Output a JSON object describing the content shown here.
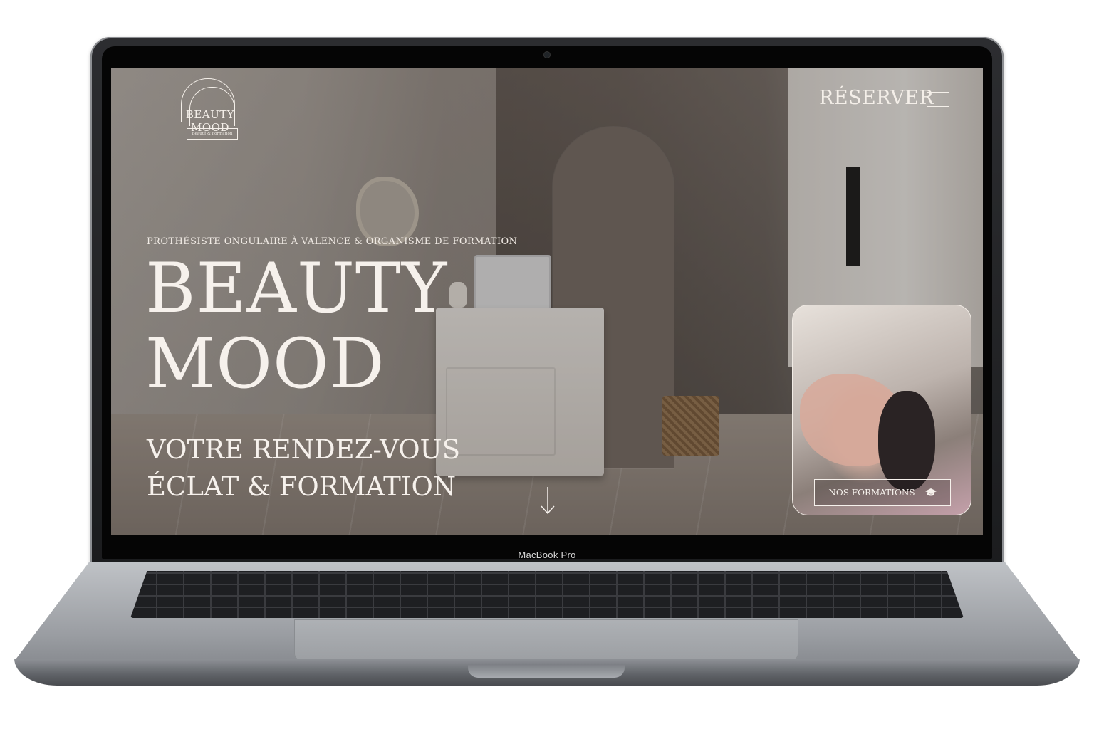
{
  "device": {
    "label": "MacBook Pro"
  },
  "site": {
    "logo": {
      "name": "BEAUTY MOOD",
      "subtitle": "Beauté & Formation"
    },
    "header": {
      "reserve_label": "RÉSERVER"
    },
    "hero": {
      "tagline": "PROTHÉSISTE ONGULAIRE À VALENCE & ORGANISME DE FORMATION",
      "title_line1": "BEAUTY",
      "title_line2": "MOOD",
      "subtitle_line1": "VOTRE RENDEZ-VOUS",
      "subtitle_line2": "ÉCLAT & FORMATION"
    },
    "card": {
      "button_label": "NOS FORMATIONS",
      "button_icon": "graduation-cap-icon"
    }
  },
  "colors": {
    "text_light": "#f6f1ec"
  }
}
